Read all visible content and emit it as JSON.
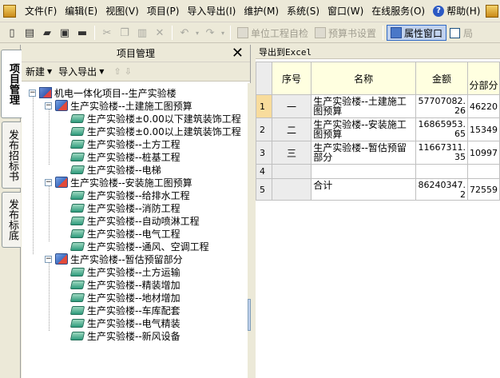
{
  "menubar": {
    "items": [
      "文件(F)",
      "编辑(E)",
      "视图(V)",
      "项目(P)",
      "导入导出(I)",
      "维护(M)",
      "系统(S)",
      "窗口(W)",
      "在线服务(O)",
      "帮助(H)"
    ]
  },
  "toolbar": {
    "unit_check": "单位工程自检",
    "budget_settings": "预算书设置",
    "property_window": "属性窗口",
    "truncated": "局"
  },
  "sidetabs": [
    "项目管理",
    "发布招标书",
    "发布标底"
  ],
  "panel": {
    "title": "项目管理",
    "close": "✕",
    "new_label": "新建",
    "import_export_label": "导入导出",
    "tree": {
      "root": "机电一体化项目--生产实验楼",
      "groups": [
        {
          "label": "生产实验楼--土建施工图预算",
          "children": [
            "生产实验楼±0.00以下建筑装饰工程",
            "生产实验楼±0.00以上建筑装饰工程",
            "生产实验楼--土方工程",
            "生产实验楼--桩基工程",
            "生产实验楼--电梯"
          ]
        },
        {
          "label": "生产实验楼--安装施工图预算",
          "children": [
            "生产实验楼--给排水工程",
            "生产实验楼--消防工程",
            "生产实验楼--自动喷淋工程",
            "生产实验楼--电气工程",
            "生产实验楼--通风、空调工程"
          ]
        },
        {
          "label": "生产实验楼--暂估预留部分",
          "children": [
            "生产实验楼--土方运输",
            "生产实验楼--精装增加",
            "生产实验楼--地材增加",
            "生产实验楼--车库配套",
            "生产实验楼--电气精装",
            "生产实验楼--新风设备"
          ]
        }
      ]
    }
  },
  "right": {
    "export_label": "导出到Excel",
    "headers": {
      "seq": "序号",
      "name": "名称",
      "amount": "金额",
      "part": "分部分"
    },
    "rows": [
      {
        "num": "1",
        "seq": "一",
        "name": "生产实验楼--土建施工图预算",
        "amount": "57707082.26",
        "part": "46220"
      },
      {
        "num": "2",
        "seq": "二",
        "name": "生产实验楼--安装施工图预算",
        "amount": "16865953.65",
        "part": "15349"
      },
      {
        "num": "3",
        "seq": "三",
        "name": "生产实验楼--暂估预留部分",
        "amount": "11667311.35",
        "part": "10997"
      },
      {
        "num": "4",
        "seq": "",
        "name": "",
        "amount": "",
        "part": ""
      },
      {
        "num": "5",
        "seq": "",
        "name": "合计",
        "amount": "86240347.2",
        "part": "72559"
      }
    ]
  }
}
